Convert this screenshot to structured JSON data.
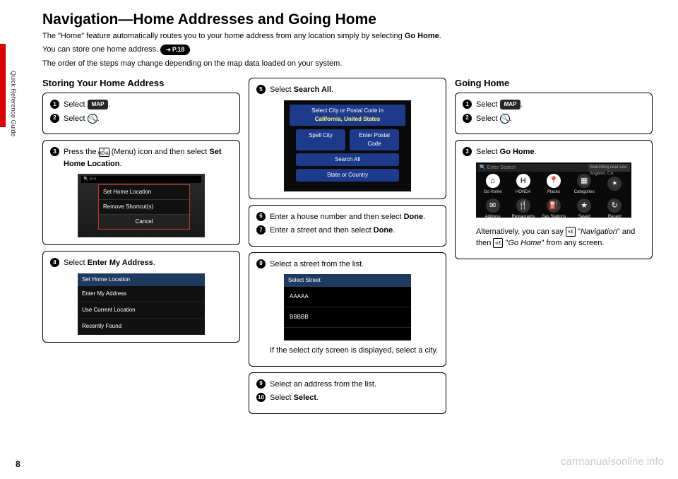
{
  "side_tab": "Quick Reference Guide",
  "title": "Navigation—Home Addresses and Going Home",
  "intro1a": "The \"Home\" feature automatically routes you to your home address from any location simply by selecting ",
  "intro1b": "Go Home",
  "intro1c": ".",
  "intro2": "You can store one home address.",
  "page_ref": "P.18",
  "intro3": "The order of the steps may change depending on the map data loaded on your system.",
  "col1": {
    "heading": "Storing Your Home Address",
    "card1": {
      "s1a": "Select ",
      "s1chip": "MAP",
      "s1b": ".",
      "s2a": "Select ",
      "s2icon": "🔍",
      "s2b": "."
    },
    "card2": {
      "s3a": "Press the ",
      "s3icon": "MENU",
      "s3b": " (Menu) icon and then select ",
      "s3c": "Set Home Location",
      "s3d": ".",
      "mock": {
        "top": "Ent",
        "r1": "Set Home Location",
        "r2": "Remove Shortcut(s)",
        "r3": "Cancel"
      }
    },
    "card3": {
      "s4a": "Select ",
      "s4b": "Enter My Address",
      "s4c": ".",
      "mock": {
        "hdr": "Set Home Location",
        "o1": "Enter My Address",
        "o2": "Use Current Location",
        "o3": "Recently Found"
      }
    }
  },
  "col2": {
    "card1": {
      "s5a": "Select ",
      "s5b": "Search All",
      "s5c": ".",
      "mock": {
        "t1": "Select City or Postal Code in",
        "t2": "California, United States",
        "p1": "Spell City",
        "p2": "Enter Postal Code",
        "p3": "Search All",
        "p4": "State or Country"
      }
    },
    "card2": {
      "s6a": "Enter a house number and then select ",
      "s6b": "Done",
      "s6c": ".",
      "s7a": "Enter a street and then select ",
      "s7b": "Done",
      "s7c": "."
    },
    "card3": {
      "s8": "Select a street from the list.",
      "mock": {
        "hdr": "Select Street",
        "o1": "AAAAA",
        "o2": "BBBBB"
      },
      "note": "If the select city screen is displayed, select a city."
    },
    "card4": {
      "s9": "Select an address from the list.",
      "s10a": "Select ",
      "s10b": "Select",
      "s10c": "."
    }
  },
  "col3": {
    "heading": "Going Home",
    "card1": {
      "s1a": "Select ",
      "s1chip": "MAP",
      "s1b": ".",
      "s2a": "Select ",
      "s2icon": "🔍",
      "s2b": "."
    },
    "card2": {
      "s3a": "Select ",
      "s3b": "Go Home",
      "s3c": ".",
      "mock": {
        "search": "Enter Search",
        "loc": "Searching near Los Angeles, CA",
        "i1": "Go Home",
        "i2": "HONDA",
        "i3": "Places",
        "i4": "Categories",
        "i5": "",
        "i6": "Address",
        "i7": "Restaurants",
        "i8": "Gas Stations",
        "i9": "Saved",
        "i10": "Recent"
      },
      "alt1": "Alternatively, you can say ",
      "alt2": "\"",
      "alt2i": "Navigation",
      "alt3": "\" and then ",
      "alt4": " \"",
      "alt4i": "Go Home",
      "alt5": "\" from any screen."
    }
  },
  "page_num": "8",
  "watermark": "carmanualsonline.info"
}
